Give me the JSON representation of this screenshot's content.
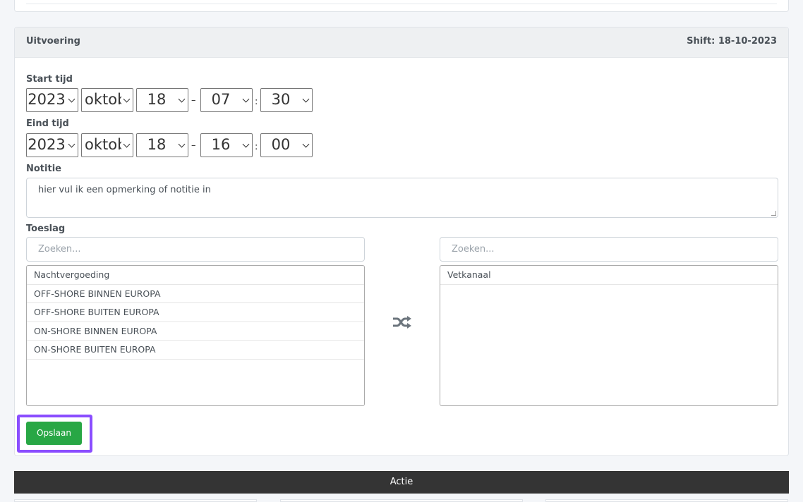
{
  "section": {
    "title": "Uitvoering",
    "shift_label": "Shift: 18-10-2023"
  },
  "start": {
    "label": "Start tijd",
    "year": "2023",
    "month": "oktober",
    "day": "18",
    "hour": "07",
    "minute": "30"
  },
  "end": {
    "label": "Eind tijd",
    "year": "2023",
    "month": "oktober",
    "day": "18",
    "hour": "16",
    "minute": "00"
  },
  "separators": {
    "date_time": "–",
    "time": ":"
  },
  "note": {
    "label": "Notitie",
    "value": "hier vul ik een opmerking of notitie in"
  },
  "surcharge": {
    "label": "Toeslag",
    "left_search_placeholder": "Zoeken...",
    "right_search_placeholder": "Zoeken...",
    "available": [
      "Nachtvergoeding",
      "OFF-SHORE BINNEN EUROPA",
      "OFF-SHORE BUITEN EUROPA",
      "ON-SHORE BINNEN EUROPA",
      "ON-SHORE BUITEN EUROPA"
    ],
    "selected": [
      "Vetkanaal"
    ],
    "transfer_icon": "shuffle-icon"
  },
  "actions": {
    "save_label": "Opslaan",
    "actie_label": "Actie"
  },
  "colors": {
    "save_button": "#28a745",
    "highlight": "#8a4dff",
    "actie_bar": "#343434"
  }
}
